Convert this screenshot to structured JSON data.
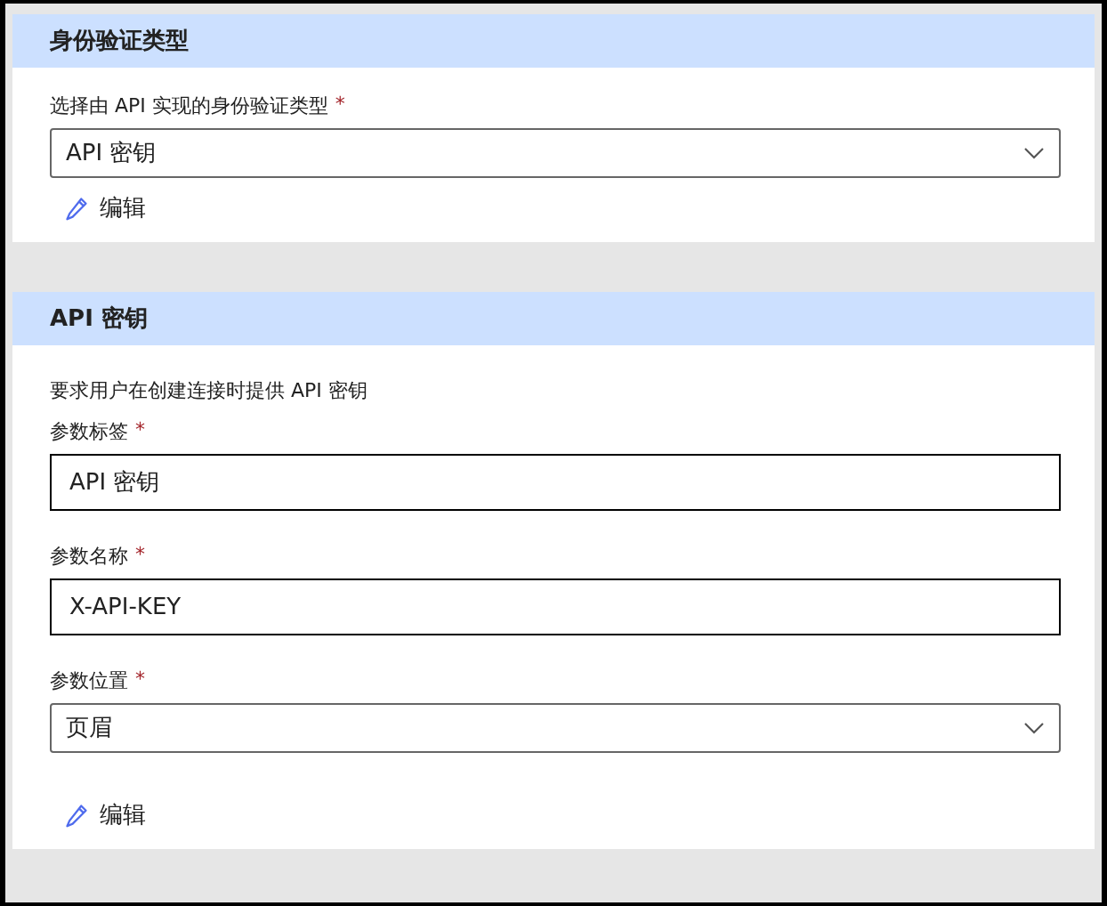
{
  "sections": [
    {
      "title": "身份验证类型",
      "fields": [
        {
          "kind": "select",
          "label": "选择由 API 实现的身份验证类型",
          "required_mark": "*",
          "value": "API 密钥"
        }
      ],
      "edit": "编辑"
    },
    {
      "title": "API 密钥",
      "description": "要求用户在创建连接时提供 API 密钥",
      "fields": [
        {
          "kind": "input",
          "label": "参数标签",
          "required_mark": "*",
          "value": "API 密钥"
        },
        {
          "kind": "input",
          "label": "参数名称",
          "required_mark": "*",
          "value": "X-API-KEY"
        },
        {
          "kind": "select",
          "label": "参数位置",
          "required_mark": "*",
          "value": "页眉"
        }
      ],
      "edit": "编辑"
    }
  ]
}
